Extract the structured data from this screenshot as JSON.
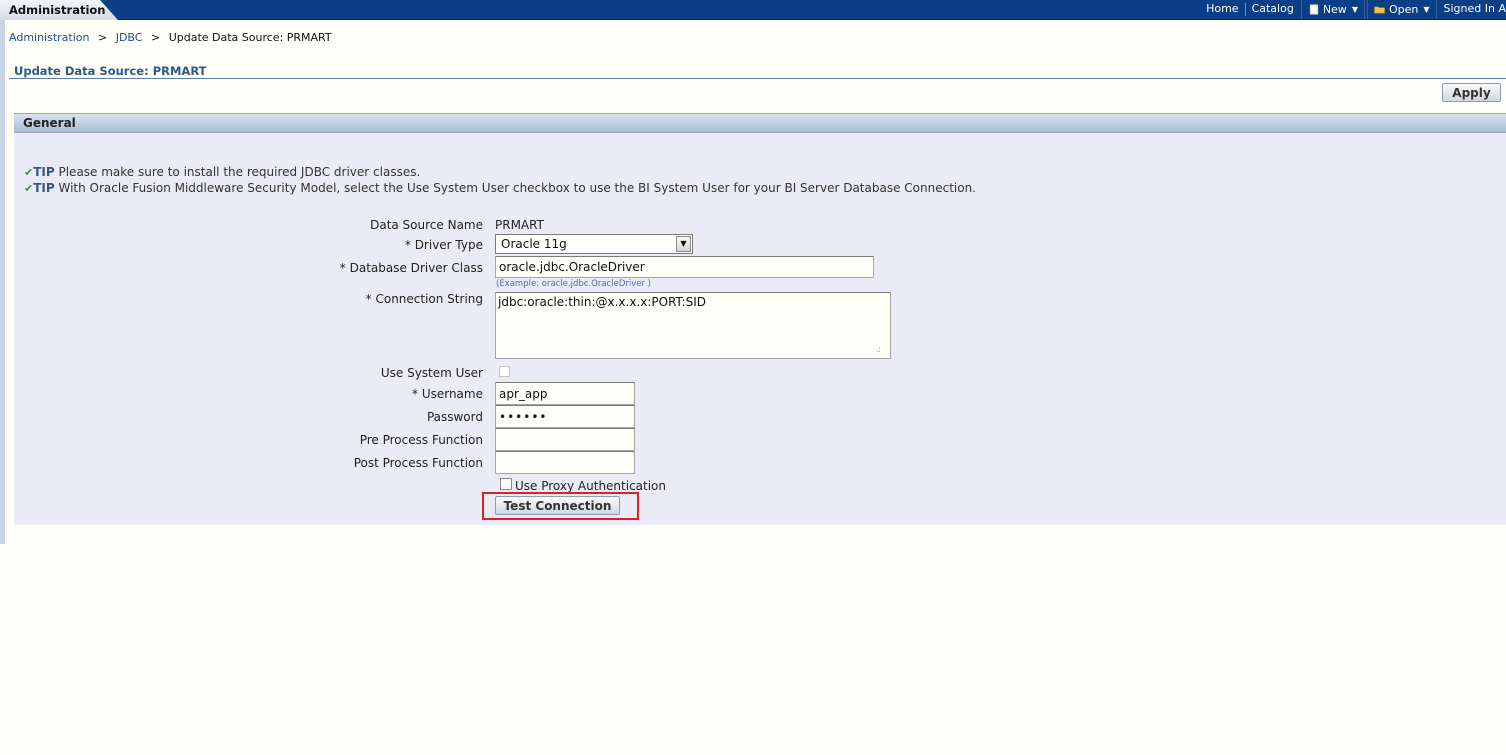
{
  "header": {
    "app_tab": "Administration",
    "links": [
      "Home",
      "Catalog"
    ],
    "new_label": "New",
    "open_label": "Open",
    "signed_in": "Signed In A"
  },
  "breadcrumb": {
    "items": [
      "Administration",
      "JDBC"
    ],
    "current": "Update Data Source: PRMART",
    "separator": ">"
  },
  "page_title": "Update Data Source: PRMART",
  "apply_label": "Apply",
  "section": {
    "title": "General",
    "tips": [
      {
        "label": "TIP",
        "text": " Please make sure to install the required JDBC driver classes."
      },
      {
        "label": "TIP",
        "text": " With Oracle Fusion Middleware Security Model, select the Use System User checkbox to use the BI System User for your BI Server Database Connection."
      }
    ]
  },
  "form": {
    "data_source_name_label": "Data Source Name",
    "data_source_name_value": "PRMART",
    "driver_type_label": "* Driver Type",
    "driver_type_value": "Oracle 11g",
    "driver_class_label": "* Database Driver Class",
    "driver_class_value": "oracle.jdbc.OracleDriver",
    "driver_class_hint": "(Example: oracle.jdbc.OracleDriver )",
    "connection_string_label": "* Connection String",
    "connection_string_value": "jdbc:oracle:thin:@x.x.x.x:PORT:SID",
    "use_system_user_label": "Use System User",
    "username_label": "* Username",
    "username_value": "apr_app",
    "password_label": "Password",
    "password_value": "••••••",
    "pre_process_label": "Pre Process Function",
    "pre_process_value": "",
    "post_process_label": "Post Process Function",
    "post_process_value": "",
    "proxy_auth_label": "Use Proxy Authentication",
    "test_connection_label": "Test Connection"
  },
  "colors": {
    "topbar": "#0a3e86",
    "panel_bg": "#ebebf8",
    "title": "#2d5987",
    "highlight": "#e01e27"
  },
  "icons": [
    "new-document-icon",
    "open-folder-icon",
    "chevron-down-icon",
    "check-icon",
    "dropdown-arrow-icon",
    "resize-grip-icon"
  ]
}
